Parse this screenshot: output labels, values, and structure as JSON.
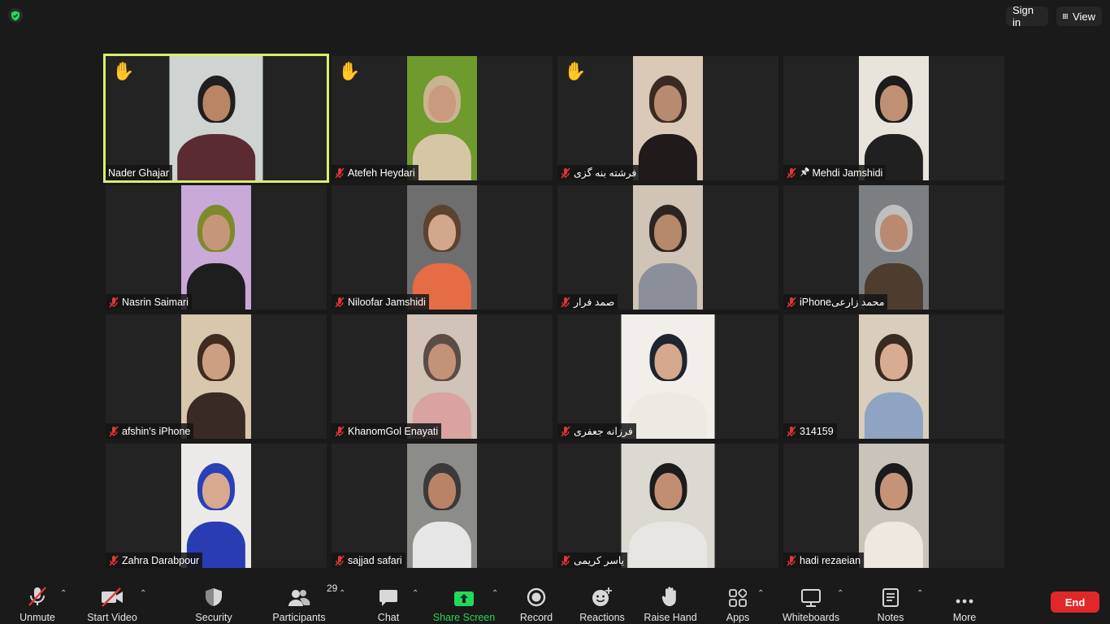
{
  "topbar": {
    "sign_in": "Sign in",
    "view": "View"
  },
  "participants": [
    {
      "name": "Nader Ghajar",
      "hand": true,
      "muted": false,
      "active": true,
      "video": "w115",
      "bg": "#cfd3d2",
      "hair": "#1f1f1f",
      "skin": "#b98565",
      "shirt": "#5a2b33"
    },
    {
      "name": "Atefeh Heydari",
      "hand": true,
      "muted": true,
      "video": "w86",
      "bg": "#6f9a2e",
      "hair": "#c9b48f",
      "skin": "#c99a80",
      "shirt": "#d7c6a5"
    },
    {
      "name": "فرشته بنه گزی",
      "hand": true,
      "muted": true,
      "video": "w86",
      "bg": "#d9c9b6",
      "hair": "#3a2a22",
      "skin": "#b78a71",
      "shirt": "#201a1a"
    },
    {
      "name": "Mehdi Jamshidi",
      "hand": false,
      "muted": true,
      "pin": true,
      "video": "w86",
      "bg": "#e8e4dc",
      "hair": "#1c1c1c",
      "skin": "#c09074",
      "shirt": "#202020"
    },
    {
      "name": "Nasrin Saimari",
      "hand": false,
      "muted": true,
      "video": "w86",
      "bg": "#c9a9d8",
      "hair": "#7d8a2c",
      "skin": "#c69678",
      "shirt": "#1e1e1e"
    },
    {
      "name": "Niloofar Jamshidi",
      "hand": false,
      "muted": true,
      "video": "w86",
      "bg": "#6e6e6e",
      "hair": "#5c4330",
      "skin": "#d3a78c",
      "shirt": "#e56c45"
    },
    {
      "name": "صمد فرار",
      "hand": false,
      "muted": true,
      "video": "w86",
      "bg": "#cfc4b5",
      "hair": "#2b2521",
      "skin": "#b6886c",
      "shirt": "#8b8f9a"
    },
    {
      "name": "iPhoneمحمد زارعی",
      "hand": false,
      "muted": true,
      "video": "w86",
      "bg": "#7c7f82",
      "hair": "#bfbfbf",
      "skin": "#b98a70",
      "shirt": "#4c3d2f"
    },
    {
      "name": "afshin's iPhone",
      "hand": false,
      "muted": true,
      "video": "w86",
      "bg": "#d8c7ad",
      "hair": "#3f2b22",
      "skin": "#cc9f83",
      "shirt": "#3a2a25"
    },
    {
      "name": "KhanomGol Enayati",
      "hand": false,
      "muted": true,
      "video": "w86",
      "bg": "#d2c3b8",
      "hair": "#5b4c46",
      "skin": "#c29279",
      "shirt": "#d8a3a0"
    },
    {
      "name": "فرزانه جعفری",
      "hand": false,
      "muted": true,
      "video": "w115",
      "bg": "#f2efea",
      "hair": "#1f2530",
      "skin": "#d6a88d",
      "shirt": "#eee9e2"
    },
    {
      "name": "314159",
      "hand": false,
      "muted": true,
      "video": "w86",
      "bg": "#d9cdbd",
      "hair": "#3b2a20",
      "skin": "#d8ac93",
      "shirt": "#8ea4c2"
    },
    {
      "name": "Zahra Darabpour",
      "hand": false,
      "muted": true,
      "video": "w86",
      "bg": "#eceae8",
      "hair": "#2a40b8",
      "skin": "#d8a88f",
      "shirt": "#2a3cb4"
    },
    {
      "name": "sajjad safari",
      "hand": false,
      "muted": true,
      "video": "w86",
      "bg": "#8c8c88",
      "hair": "#3a3a3a",
      "skin": "#b98466",
      "shirt": "#e6e6e6"
    },
    {
      "name": "یاسر کریمی",
      "hand": false,
      "muted": true,
      "video": "w115",
      "bg": "#dcd8d2",
      "hair": "#1c1c1c",
      "skin": "#c18e72",
      "shirt": "#e8e6e2"
    },
    {
      "name": "hadi rezaeian",
      "hand": false,
      "muted": true,
      "video": "w86",
      "bg": "#cac3b9",
      "hair": "#1b1b1b",
      "skin": "#c59478",
      "shirt": "#efe8de"
    }
  ],
  "toolbar": {
    "unmute": "Unmute",
    "start_video": "Start Video",
    "security": "Security",
    "participants": "Participants",
    "participants_count": "29",
    "chat": "Chat",
    "share_screen": "Share Screen",
    "record": "Record",
    "reactions": "Reactions",
    "raise_hand": "Raise Hand",
    "apps": "Apps",
    "whiteboards": "Whiteboards",
    "notes": "Notes",
    "more": "More",
    "end": "End"
  },
  "colors": {
    "accent_green": "#23d959",
    "end_red": "#e02828",
    "active_border": "#d7f06a",
    "muted_red": "#e0353b"
  }
}
